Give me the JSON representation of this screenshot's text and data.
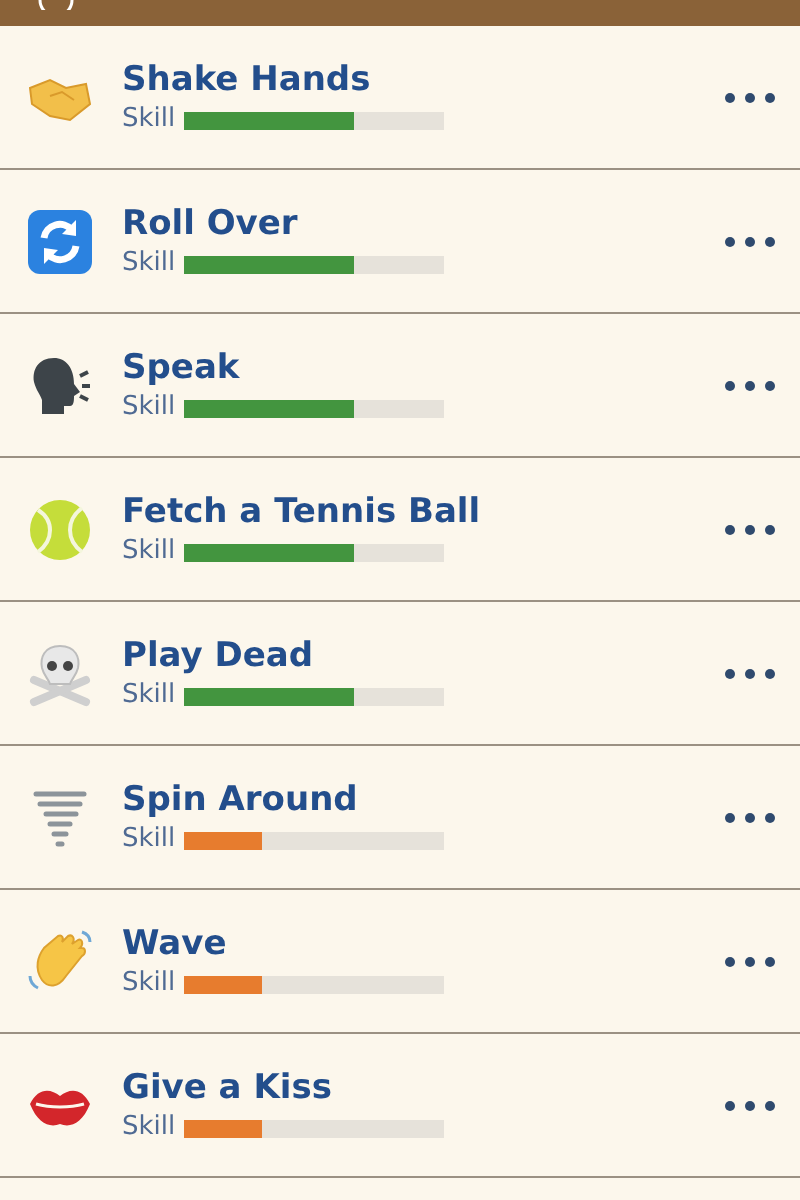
{
  "skills": [
    {
      "name": "Shake Hands",
      "label": "Skill",
      "level": 0.65,
      "color": "#43953f"
    },
    {
      "name": "Roll Over",
      "label": "Skill",
      "level": 0.65,
      "color": "#43953f"
    },
    {
      "name": "Speak",
      "label": "Skill",
      "level": 0.65,
      "color": "#43953f"
    },
    {
      "name": "Fetch a Tennis Ball",
      "label": "Skill",
      "level": 0.65,
      "color": "#43953f"
    },
    {
      "name": "Play Dead",
      "label": "Skill",
      "level": 0.65,
      "color": "#43953f"
    },
    {
      "name": "Spin Around",
      "label": "Skill",
      "level": 0.3,
      "color": "#e77c2e"
    },
    {
      "name": "Wave",
      "label": "Skill",
      "level": 0.3,
      "color": "#e77c2e"
    },
    {
      "name": "Give a Kiss",
      "label": "Skill",
      "level": 0.3,
      "color": "#e77c2e"
    }
  ]
}
